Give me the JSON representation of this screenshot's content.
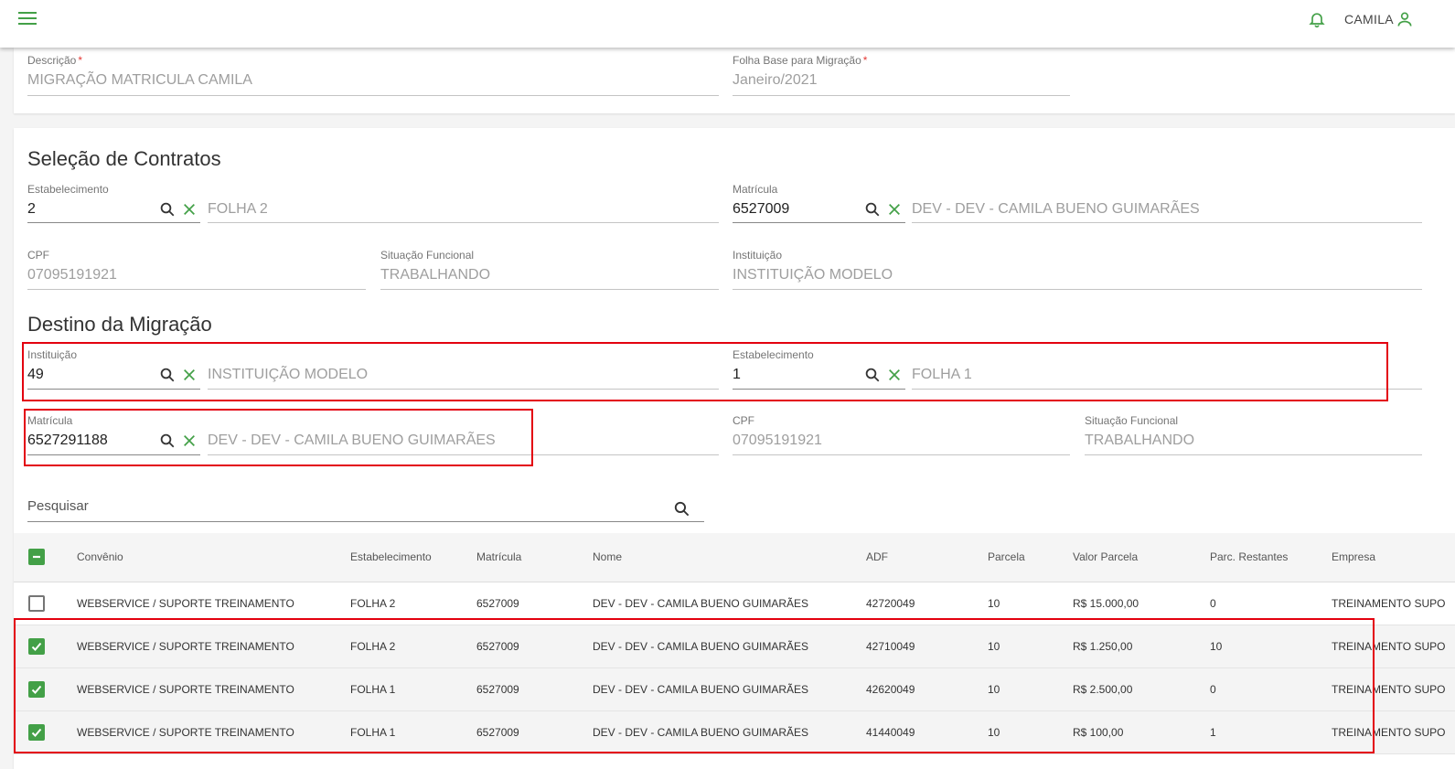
{
  "header": {
    "user_name": "CAMILA"
  },
  "form1": {
    "descricao_label": "Descrição",
    "descricao_value": "MIGRAÇÃO MATRICULA CAMILA",
    "folha_label": "Folha Base para Migração",
    "folha_value": "Janeiro/2021",
    "required_mark": "*"
  },
  "selecao": {
    "title": "Seleção de Contratos",
    "estabelecimento_label": "Estabelecimento",
    "estabelecimento_value": "2",
    "estabelecimento_desc": "FOLHA 2",
    "matricula_label": "Matrícula",
    "matricula_value": "6527009",
    "matricula_desc": "DEV - DEV - CAMILA BUENO GUIMARÃES",
    "cpf_label": "CPF",
    "cpf_value": "07095191921",
    "situacao_label": "Situação Funcional",
    "situacao_value": "TRABALHANDO",
    "instituicao_label": "Instituição",
    "instituicao_value": "INSTITUIÇÃO MODELO"
  },
  "destino": {
    "title": "Destino da Migração",
    "instituicao_label": "Instituição",
    "instituicao_value": "49",
    "instituicao_desc": "INSTITUIÇÃO MODELO",
    "estabelecimento_label": "Estabelecimento",
    "estabelecimento_value": "1",
    "estabelecimento_desc": "FOLHA 1",
    "matricula_label": "Matrícula",
    "matricula_value": "6527291188",
    "matricula_desc": "DEV - DEV - CAMILA BUENO GUIMARÃES",
    "cpf_label": "CPF",
    "cpf_value": "07095191921",
    "situacao_label": "Situação Funcional",
    "situacao_value": "TRABALHANDO"
  },
  "search": {
    "placeholder": "Pesquisar"
  },
  "table": {
    "columns": [
      "Convênio",
      "Estabelecimento",
      "Matrícula",
      "Nome",
      "ADF",
      "Parcela",
      "Valor Parcela",
      "Parc. Restantes",
      "Empresa"
    ],
    "rows": [
      {
        "checked": false,
        "convenio": "WEBSERVICE / SUPORTE TREINAMENTO",
        "estabelecimento": "FOLHA 2",
        "matricula": "6527009",
        "nome": "DEV - DEV - CAMILA BUENO GUIMARÃES",
        "adf": "42720049",
        "parcela": "10",
        "valor": "R$ 15.000,00",
        "restantes": "0",
        "empresa": "TREINAMENTO SUPO"
      },
      {
        "checked": true,
        "convenio": "WEBSERVICE / SUPORTE TREINAMENTO",
        "estabelecimento": "FOLHA 2",
        "matricula": "6527009",
        "nome": "DEV - DEV - CAMILA BUENO GUIMARÃES",
        "adf": "42710049",
        "parcela": "10",
        "valor": "R$ 1.250,00",
        "restantes": "10",
        "empresa": "TREINAMENTO SUPO"
      },
      {
        "checked": true,
        "convenio": "WEBSERVICE / SUPORTE TREINAMENTO",
        "estabelecimento": "FOLHA 1",
        "matricula": "6527009",
        "nome": "DEV - DEV - CAMILA BUENO GUIMARÃES",
        "adf": "42620049",
        "parcela": "10",
        "valor": "R$ 2.500,00",
        "restantes": "0",
        "empresa": "TREINAMENTO SUPO"
      },
      {
        "checked": true,
        "convenio": "WEBSERVICE / SUPORTE TREINAMENTO",
        "estabelecimento": "FOLHA 1",
        "matricula": "6527009",
        "nome": "DEV - DEV - CAMILA BUENO GUIMARÃES",
        "adf": "41440049",
        "parcela": "10",
        "valor": "R$ 100,00",
        "restantes": "1",
        "empresa": "TREINAMENTO SUPO"
      }
    ]
  },
  "colors": {
    "accent": "#43a047",
    "highlight": "#e3000f"
  }
}
